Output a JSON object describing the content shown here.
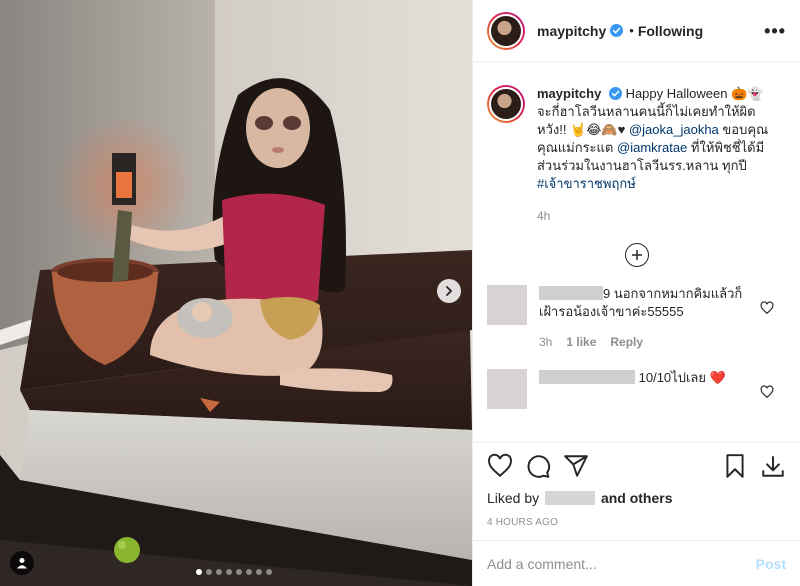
{
  "post": {
    "username": "maypitchy",
    "follow_status": "Following",
    "more_label": "•••",
    "caption_line1": "Happy Halloween 🎃👻",
    "caption_line2": "จะกี่ฮาโลวีนหลานคนนี้ก็ไม่เคยทำให้ผิดหวัง!! 🤘😂🙈♥",
    "mention1": "@jaoka_jaokha",
    "caption_line3": "ขอบคุณคุณแม่กระแต",
    "mention2": "@iamkratae",
    "caption_line4": "ที่ให้พิชชี่ได้มีส่วนร่วมในงานฮาโลวีนรร.หลาน ทุกปี",
    "hashtag": "#เจ้าขาราชพฤกษ์",
    "caption_time": "4h"
  },
  "comments": [
    {
      "name_suffix": "9",
      "text": "นอกจากหมากคิมแล้วก็ เฝ้ารอน้องเจ้าขาค่ะ55555",
      "time": "3h",
      "likes": "1 like",
      "reply": "Reply"
    },
    {
      "name_suffix": "",
      "text": "10/10ไปเลย ❤️",
      "time": "",
      "likes": "",
      "reply": ""
    }
  ],
  "footer": {
    "liked_by_prefix": "Liked by",
    "liked_by_suffix": "and others",
    "timeago": "4 HOURS AGO",
    "comment_placeholder": "Add a comment...",
    "post_label": "Post"
  },
  "icons": {
    "like": "heart-icon",
    "comment": "comment-icon",
    "share": "share-icon",
    "save": "bookmark-icon",
    "download": "download-icon",
    "verified": "verified-badge-icon",
    "next": "chevron-right-icon",
    "tagged": "person-icon",
    "load_more": "plus-circle-icon"
  },
  "colors": {
    "link": "#00376b",
    "verified": "#3897f0",
    "post_disabled": "#b2dffc",
    "meta": "#8e8e8e"
  },
  "carousel": {
    "count": 8,
    "active_index": 1
  }
}
